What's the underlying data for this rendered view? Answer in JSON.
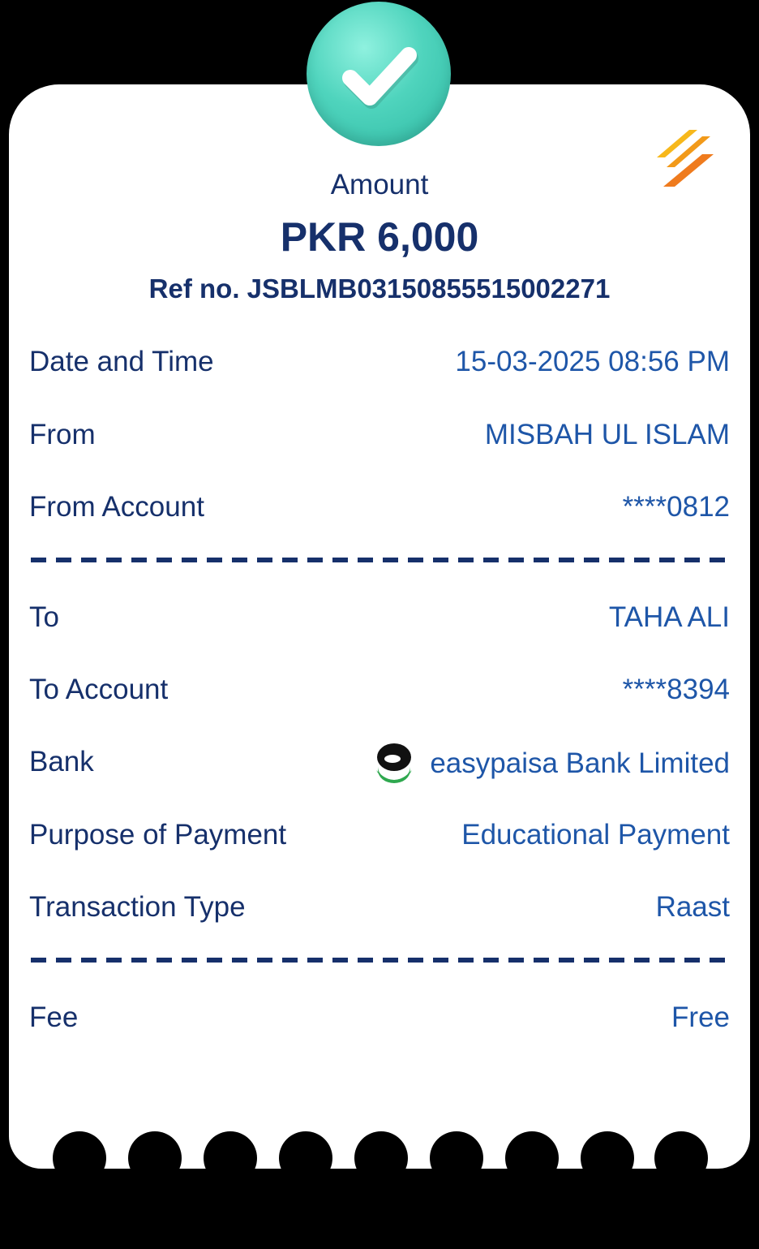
{
  "header": {
    "amount_label": "Amount",
    "amount_value": "PKR 6,000",
    "ref": "Ref no. JSBLMB031508555150022​71"
  },
  "icons": {
    "status": "check-icon",
    "brand": "brand-logo-icon",
    "bank": "easypaisa-icon"
  },
  "colors": {
    "primary_text": "#16306b",
    "value_text": "#1e56a8",
    "success": "#4fd4bd",
    "brand_orange": "#f08a1e"
  },
  "rows": [
    {
      "label": "Date and Time",
      "value": "15-03-2025 08:56 PM"
    },
    {
      "label": "From",
      "value": "MISBAH UL ISLAM"
    },
    {
      "label": "From Account",
      "value": "****0812"
    },
    {
      "label": "To",
      "value": "TAHA ALI"
    },
    {
      "label": "To Account",
      "value": "****8394"
    },
    {
      "label": "Bank",
      "value": "easypaisa Bank Limited"
    },
    {
      "label": "Purpose of Payment",
      "value": "Educational Payment"
    },
    {
      "label": "Transaction Type",
      "value": "Raast"
    },
    {
      "label": "Fee",
      "value": "Free"
    }
  ]
}
